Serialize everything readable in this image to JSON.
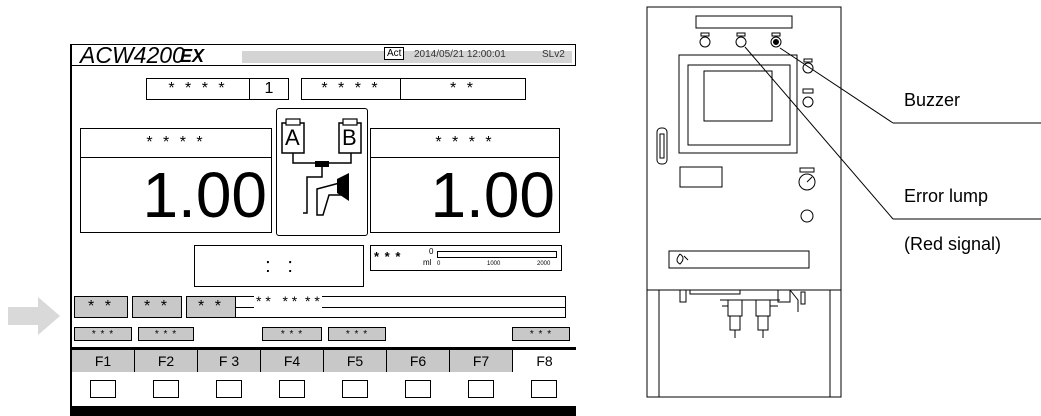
{
  "screen": {
    "model": "ACW4200",
    "model_suffix": "EX",
    "act_badge": "Act",
    "datetime": "2014/05/21 12:00:01",
    "level": "SLv2",
    "top_left_label": "* * * *",
    "top_left_value": "1",
    "top_mid_label": "* * * *",
    "top_right_value": "* *",
    "left_panel_label": "* * * *",
    "left_value": "1.00",
    "right_panel_label": "* * * *",
    "right_value": "1.00",
    "tank_a": "A",
    "tank_b": "B",
    "time_display": ":   :",
    "gauge_label": "* * *",
    "gauge_zero": "0",
    "gauge_unit": "ml",
    "gauge_ticks": [
      "0",
      "1000",
      "2000"
    ],
    "status_buttons": [
      "* *",
      "* *",
      "* *"
    ],
    "status_message": "* *   * *  * *",
    "small_buttons": [
      "* * *",
      "* * *",
      "* * *",
      "* * *",
      "* * *"
    ],
    "function_keys": [
      "F1",
      "F2",
      "F 3",
      "F4",
      "F5",
      "F6",
      "F7",
      "F8"
    ],
    "selected_key": "F8",
    "colors": {
      "panel_gray": "#c8c8c8",
      "arrow_gray": "#d9d9d9",
      "line": "#000000"
    }
  },
  "labels": {
    "buzzer": "Buzzer",
    "error_lamp": "Error lump",
    "red_signal": "(Red signal)"
  }
}
